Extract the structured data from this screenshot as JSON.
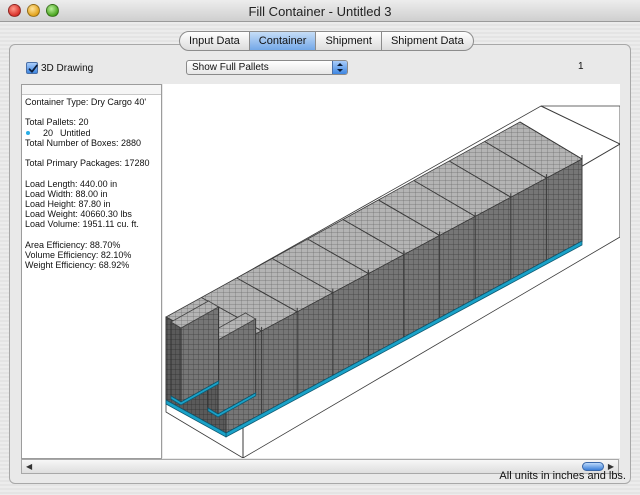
{
  "window": {
    "title": "Fill Container - Untitled 3"
  },
  "tabs": [
    {
      "label": "Input Data",
      "active": false
    },
    {
      "label": "Container",
      "active": true
    },
    {
      "label": "Shipment",
      "active": false
    },
    {
      "label": "Shipment Data",
      "active": false
    }
  ],
  "toolbar": {
    "drawing_label": "3D Drawing",
    "drawing_checked": true,
    "view_mode": "Show Full Pallets",
    "page_number": "1"
  },
  "info": {
    "container_type": "Container Type: Dry Cargo 40'",
    "total_pallets": "Total Pallets: 20",
    "pallet_count": "20",
    "pallet_name": "Untitled",
    "total_boxes": "Total Number of Boxes: 2880",
    "primary_packages": "Total Primary Packages: 17280",
    "load_length": "Load Length: 440.00 in",
    "load_width": "Load Width: 88.00 in",
    "load_height": "Load Height: 87.80 in",
    "load_weight": "Load Weight: 40660.30 lbs",
    "load_volume": "Load Volume: 1951.11 cu. ft.",
    "area_efficiency": "Area Efficiency: 88.70%",
    "volume_efficiency": "Volume Efficiency: 82.10%",
    "weight_efficiency": "Weight Efficiency: 68.92%"
  },
  "scene": {
    "pallet_layout": {
      "rows": 2,
      "columns": 10,
      "tiers": 1
    },
    "colors": {
      "box_top": "#b6b6b6",
      "box_front": "#6a6a6a",
      "box_side": "#4e4e4e",
      "pallet_base": "#1aa2c8",
      "container_line": "#3a3a3a"
    }
  },
  "status": {
    "units_text": "All units in inches and lbs."
  }
}
